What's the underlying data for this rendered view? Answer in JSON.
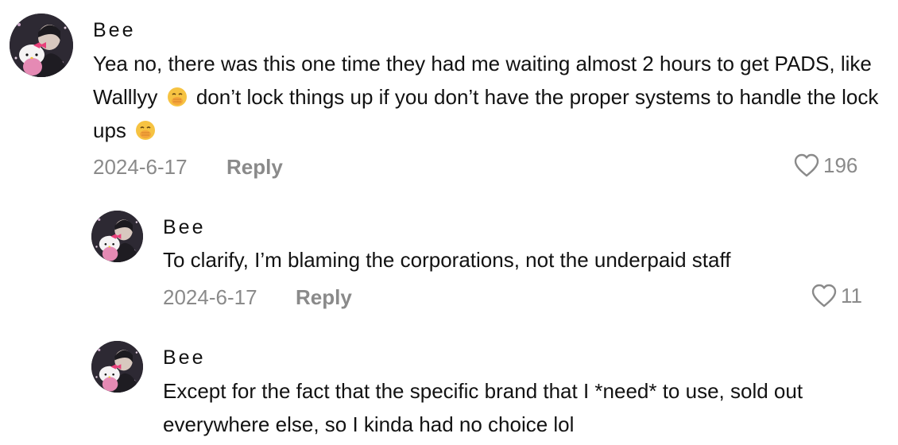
{
  "comments": [
    {
      "username": "Bee",
      "text_part1": "Yea no, there was this one time they had me waiting almost 2 hours to get PADS, like Walllyy",
      "text_part2": "don’t lock things up if you don’t have the proper systems to handle the lock ups",
      "date": "2024-6-17",
      "reply_label": "Reply",
      "likes": "196",
      "avatar_icon": "profile-photo-hello-kitty",
      "emoji_icon": "face-with-hand-over-mouth-emoji"
    },
    {
      "username": "Bee",
      "text": "To clarify, I’m blaming the corporations, not the underpaid staff",
      "date": "2024-6-17",
      "reply_label": "Reply",
      "likes": "11",
      "avatar_icon": "profile-photo-hello-kitty"
    },
    {
      "username": "Bee",
      "text": "Except for the fact that the specific brand that I *need* to use, sold out everywhere else, so I kinda had no choice lol",
      "avatar_icon": "profile-photo-hello-kitty"
    }
  ],
  "colors": {
    "text": "#121212",
    "muted": "#8a8a8a",
    "background": "#ffffff"
  }
}
